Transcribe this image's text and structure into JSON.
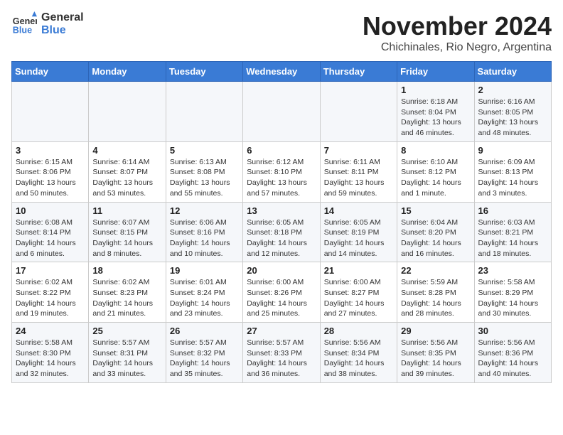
{
  "header": {
    "logo_line1": "General",
    "logo_line2": "Blue",
    "main_title": "November 2024",
    "subtitle": "Chichinales, Rio Negro, Argentina"
  },
  "calendar": {
    "days_of_week": [
      "Sunday",
      "Monday",
      "Tuesday",
      "Wednesday",
      "Thursday",
      "Friday",
      "Saturday"
    ],
    "weeks": [
      [
        {
          "day": "",
          "info": ""
        },
        {
          "day": "",
          "info": ""
        },
        {
          "day": "",
          "info": ""
        },
        {
          "day": "",
          "info": ""
        },
        {
          "day": "",
          "info": ""
        },
        {
          "day": "1",
          "info": "Sunrise: 6:18 AM\nSunset: 8:04 PM\nDaylight: 13 hours\nand 46 minutes."
        },
        {
          "day": "2",
          "info": "Sunrise: 6:16 AM\nSunset: 8:05 PM\nDaylight: 13 hours\nand 48 minutes."
        }
      ],
      [
        {
          "day": "3",
          "info": "Sunrise: 6:15 AM\nSunset: 8:06 PM\nDaylight: 13 hours\nand 50 minutes."
        },
        {
          "day": "4",
          "info": "Sunrise: 6:14 AM\nSunset: 8:07 PM\nDaylight: 13 hours\nand 53 minutes."
        },
        {
          "day": "5",
          "info": "Sunrise: 6:13 AM\nSunset: 8:08 PM\nDaylight: 13 hours\nand 55 minutes."
        },
        {
          "day": "6",
          "info": "Sunrise: 6:12 AM\nSunset: 8:10 PM\nDaylight: 13 hours\nand 57 minutes."
        },
        {
          "day": "7",
          "info": "Sunrise: 6:11 AM\nSunset: 8:11 PM\nDaylight: 13 hours\nand 59 minutes."
        },
        {
          "day": "8",
          "info": "Sunrise: 6:10 AM\nSunset: 8:12 PM\nDaylight: 14 hours\nand 1 minute."
        },
        {
          "day": "9",
          "info": "Sunrise: 6:09 AM\nSunset: 8:13 PM\nDaylight: 14 hours\nand 3 minutes."
        }
      ],
      [
        {
          "day": "10",
          "info": "Sunrise: 6:08 AM\nSunset: 8:14 PM\nDaylight: 14 hours\nand 6 minutes."
        },
        {
          "day": "11",
          "info": "Sunrise: 6:07 AM\nSunset: 8:15 PM\nDaylight: 14 hours\nand 8 minutes."
        },
        {
          "day": "12",
          "info": "Sunrise: 6:06 AM\nSunset: 8:16 PM\nDaylight: 14 hours\nand 10 minutes."
        },
        {
          "day": "13",
          "info": "Sunrise: 6:05 AM\nSunset: 8:18 PM\nDaylight: 14 hours\nand 12 minutes."
        },
        {
          "day": "14",
          "info": "Sunrise: 6:05 AM\nSunset: 8:19 PM\nDaylight: 14 hours\nand 14 minutes."
        },
        {
          "day": "15",
          "info": "Sunrise: 6:04 AM\nSunset: 8:20 PM\nDaylight: 14 hours\nand 16 minutes."
        },
        {
          "day": "16",
          "info": "Sunrise: 6:03 AM\nSunset: 8:21 PM\nDaylight: 14 hours\nand 18 minutes."
        }
      ],
      [
        {
          "day": "17",
          "info": "Sunrise: 6:02 AM\nSunset: 8:22 PM\nDaylight: 14 hours\nand 19 minutes."
        },
        {
          "day": "18",
          "info": "Sunrise: 6:02 AM\nSunset: 8:23 PM\nDaylight: 14 hours\nand 21 minutes."
        },
        {
          "day": "19",
          "info": "Sunrise: 6:01 AM\nSunset: 8:24 PM\nDaylight: 14 hours\nand 23 minutes."
        },
        {
          "day": "20",
          "info": "Sunrise: 6:00 AM\nSunset: 8:26 PM\nDaylight: 14 hours\nand 25 minutes."
        },
        {
          "day": "21",
          "info": "Sunrise: 6:00 AM\nSunset: 8:27 PM\nDaylight: 14 hours\nand 27 minutes."
        },
        {
          "day": "22",
          "info": "Sunrise: 5:59 AM\nSunset: 8:28 PM\nDaylight: 14 hours\nand 28 minutes."
        },
        {
          "day": "23",
          "info": "Sunrise: 5:58 AM\nSunset: 8:29 PM\nDaylight: 14 hours\nand 30 minutes."
        }
      ],
      [
        {
          "day": "24",
          "info": "Sunrise: 5:58 AM\nSunset: 8:30 PM\nDaylight: 14 hours\nand 32 minutes."
        },
        {
          "day": "25",
          "info": "Sunrise: 5:57 AM\nSunset: 8:31 PM\nDaylight: 14 hours\nand 33 minutes."
        },
        {
          "day": "26",
          "info": "Sunrise: 5:57 AM\nSunset: 8:32 PM\nDaylight: 14 hours\nand 35 minutes."
        },
        {
          "day": "27",
          "info": "Sunrise: 5:57 AM\nSunset: 8:33 PM\nDaylight: 14 hours\nand 36 minutes."
        },
        {
          "day": "28",
          "info": "Sunrise: 5:56 AM\nSunset: 8:34 PM\nDaylight: 14 hours\nand 38 minutes."
        },
        {
          "day": "29",
          "info": "Sunrise: 5:56 AM\nSunset: 8:35 PM\nDaylight: 14 hours\nand 39 minutes."
        },
        {
          "day": "30",
          "info": "Sunrise: 5:56 AM\nSunset: 8:36 PM\nDaylight: 14 hours\nand 40 minutes."
        }
      ]
    ]
  }
}
